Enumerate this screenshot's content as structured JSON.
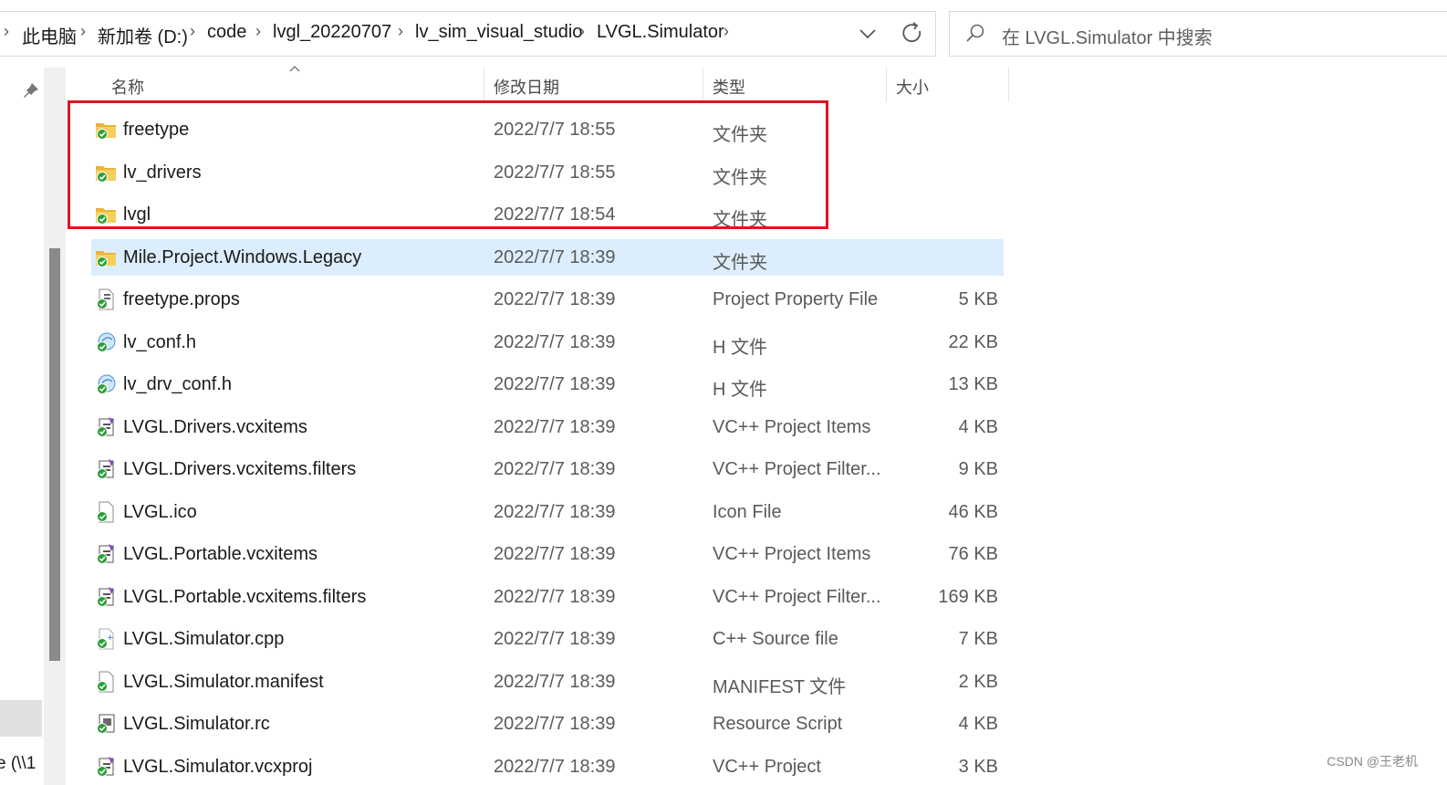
{
  "breadcrumb": [
    {
      "label": "此电脑"
    },
    {
      "label": "新加卷 (D:)"
    },
    {
      "label": "code"
    },
    {
      "label": "lvgl_20220707"
    },
    {
      "label": "lv_sim_visual_studio"
    },
    {
      "label": "LVGL.Simulator"
    }
  ],
  "search": {
    "placeholder": "在 LVGL.Simulator 中搜索"
  },
  "columns": {
    "name": "名称",
    "date": "修改日期",
    "type": "类型",
    "size": "大小"
  },
  "nav": {
    "partial_label": "e (\\\\1"
  },
  "files": [
    {
      "name": "freetype",
      "date": "2022/7/7 18:55",
      "type": "文件夹",
      "size": "",
      "icon": "folder-icon"
    },
    {
      "name": "lv_drivers",
      "date": "2022/7/7 18:55",
      "type": "文件夹",
      "size": "",
      "icon": "folder-icon"
    },
    {
      "name": "lvgl",
      "date": "2022/7/7 18:54",
      "type": "文件夹",
      "size": "",
      "icon": "folder-icon"
    },
    {
      "name": "Mile.Project.Windows.Legacy",
      "date": "2022/7/7 18:39",
      "type": "文件夹",
      "size": "",
      "icon": "folder-icon",
      "selected": true
    },
    {
      "name": "freetype.props",
      "date": "2022/7/7 18:39",
      "type": "Project Property File",
      "size": "5 KB",
      "icon": "props-file-icon"
    },
    {
      "name": "lv_conf.h",
      "date": "2022/7/7 18:39",
      "type": "H 文件",
      "size": "22 KB",
      "icon": "header-file-icon"
    },
    {
      "name": "lv_drv_conf.h",
      "date": "2022/7/7 18:39",
      "type": "H 文件",
      "size": "13 KB",
      "icon": "header-file-icon"
    },
    {
      "name": "LVGL.Drivers.vcxitems",
      "date": "2022/7/7 18:39",
      "type": "VC++ Project Items",
      "size": "4 KB",
      "icon": "vc-project-icon"
    },
    {
      "name": "LVGL.Drivers.vcxitems.filters",
      "date": "2022/7/7 18:39",
      "type": "VC++ Project Filter...",
      "size": "9 KB",
      "icon": "vc-filter-icon"
    },
    {
      "name": "LVGL.ico",
      "date": "2022/7/7 18:39",
      "type": "Icon File",
      "size": "46 KB",
      "icon": "ico-file-icon"
    },
    {
      "name": "LVGL.Portable.vcxitems",
      "date": "2022/7/7 18:39",
      "type": "VC++ Project Items",
      "size": "76 KB",
      "icon": "vc-project-icon"
    },
    {
      "name": "LVGL.Portable.vcxitems.filters",
      "date": "2022/7/7 18:39",
      "type": "VC++ Project Filter...",
      "size": "169 KB",
      "icon": "vc-filter-icon"
    },
    {
      "name": "LVGL.Simulator.cpp",
      "date": "2022/7/7 18:39",
      "type": "C++ Source file",
      "size": "7 KB",
      "icon": "cpp-file-icon"
    },
    {
      "name": "LVGL.Simulator.manifest",
      "date": "2022/7/7 18:39",
      "type": "MANIFEST 文件",
      "size": "2 KB",
      "icon": "generic-file-icon"
    },
    {
      "name": "LVGL.Simulator.rc",
      "date": "2022/7/7 18:39",
      "type": "Resource Script",
      "size": "4 KB",
      "icon": "rc-file-icon"
    },
    {
      "name": "LVGL.Simulator.vcxproj",
      "date": "2022/7/7 18:39",
      "type": "VC++ Project",
      "size": "3 KB",
      "icon": "vc-project-icon"
    }
  ],
  "watermark": "CSDN @王老机",
  "colors": {
    "selection": "#dceefd",
    "highlight_box": "#e0141e",
    "sync_badge": "#2e9e3a",
    "folder": "#f4c542"
  }
}
